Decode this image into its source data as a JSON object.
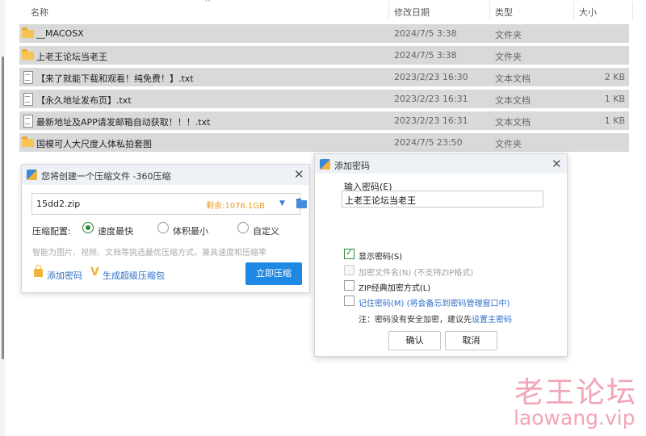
{
  "header": {
    "name": "名称",
    "date": "修改日期",
    "type": "类型",
    "size": "大小"
  },
  "files": [
    {
      "name": "__MACOSX",
      "date": "2024/7/5 3:38",
      "type": "文件夹",
      "size": "",
      "kind": "folder"
    },
    {
      "name": "上老王论坛当老王",
      "date": "2024/7/5 3:38",
      "type": "文件夹",
      "size": "",
      "kind": "folder"
    },
    {
      "name": "【来了就能下载和观看！纯免费！】.txt",
      "date": "2023/2/23 16:30",
      "type": "文本文档",
      "size": "2 KB",
      "kind": "doc"
    },
    {
      "name": "【永久地址发布页】.txt",
      "date": "2023/2/23 16:31",
      "type": "文本文档",
      "size": "1 KB",
      "kind": "doc"
    },
    {
      "name": "最新地址及APP请发邮箱自动获取！！！.txt",
      "date": "2023/2/23 16:31",
      "type": "文本文档",
      "size": "1 KB",
      "kind": "doc"
    },
    {
      "name": "国模可人大尺度人体私拍套图",
      "date": "2024/7/5 23:50",
      "type": "文件夹",
      "size": "",
      "kind": "folder"
    }
  ],
  "zip_dialog": {
    "title": "您将创建一个压缩文件 -360压缩",
    "filename": "15dd2.zip",
    "free_space": "剩余:1076.1GB",
    "config_label": "压缩配置:",
    "options": [
      "速度最快",
      "体积最小",
      "自定义"
    ],
    "selected_option": "速度最快",
    "hint": "智能为图片、视频、文档等挑选最优压缩方式，兼具速度和压缩率",
    "add_password": "添加密码",
    "super_package": "生成超级压缩包",
    "compress_now": "立即压缩"
  },
  "password_dialog": {
    "title": "添加密码",
    "label": "输入密码(E)",
    "value": "上老王论坛当老王",
    "show_password": "显示密码(S)",
    "encrypt_filenames": "加密文件名(N) (不支持ZIP格式)",
    "zip_classic": "ZIP经典加密方式(L)",
    "remember": "记住密码(M) (将会备忘到密码管理窗口中)",
    "note_prefix": "注：密码没有安全加密，建议先",
    "note_link": "设置主密码",
    "ok": "确认",
    "cancel": "取消",
    "show_password_checked": true
  },
  "watermark": {
    "zh": "老王论坛",
    "en": "laowang.vip"
  },
  "colors": {
    "accent": "#1e88e5",
    "link": "#2f6fc6",
    "selected_row": "#d9d9d9",
    "watermark": "#f2a5b4"
  }
}
